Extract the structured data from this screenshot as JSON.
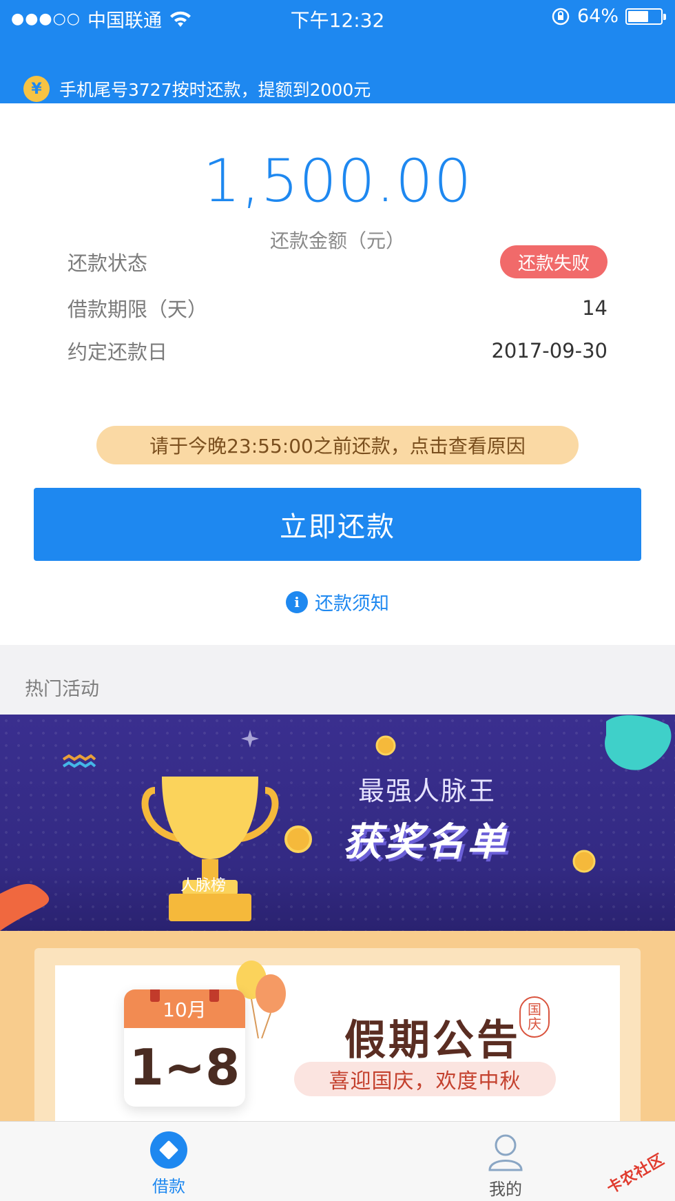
{
  "status_bar": {
    "signal": "●●●○○",
    "carrier": "中国联通",
    "time": "下午12:32",
    "battery_text": "64%",
    "battery_level": 0.64
  },
  "notice": {
    "icon": "yen-icon",
    "text": "手机尾号3727按时还款，提额到2000元"
  },
  "repayment": {
    "amount": "1,500.00",
    "amount_label": "还款金额（元）",
    "rows": [
      {
        "label": "还款状态",
        "value": "还款失败"
      },
      {
        "label": "借款期限（天）",
        "value": "14"
      },
      {
        "label": "约定还款日",
        "value": "2017-09-30"
      }
    ],
    "warning": "请于今晚23:55:00之前还款，点击查看原因",
    "pay_button": "立即还款",
    "notice_link": "还款须知"
  },
  "hot_section": {
    "title": "热门活动",
    "banner1": {
      "line1": "最强人脉王",
      "line2": "获奖名单",
      "trophy_label": "人脉榜"
    },
    "banner2": {
      "calendar_month": "10月",
      "calendar_range": "1~8",
      "title": "假期公告",
      "seal": "国庆",
      "subtitle": "喜迎国庆，欢度中秋"
    }
  },
  "tabbar": {
    "items": [
      {
        "label": "借款",
        "active": true
      },
      {
        "label": "我的",
        "active": false
      }
    ]
  },
  "watermark": "卡农社区",
  "colors": {
    "primary": "#1e88f0",
    "fail": "#f16a6a",
    "warn_bg": "#fad9a4"
  }
}
